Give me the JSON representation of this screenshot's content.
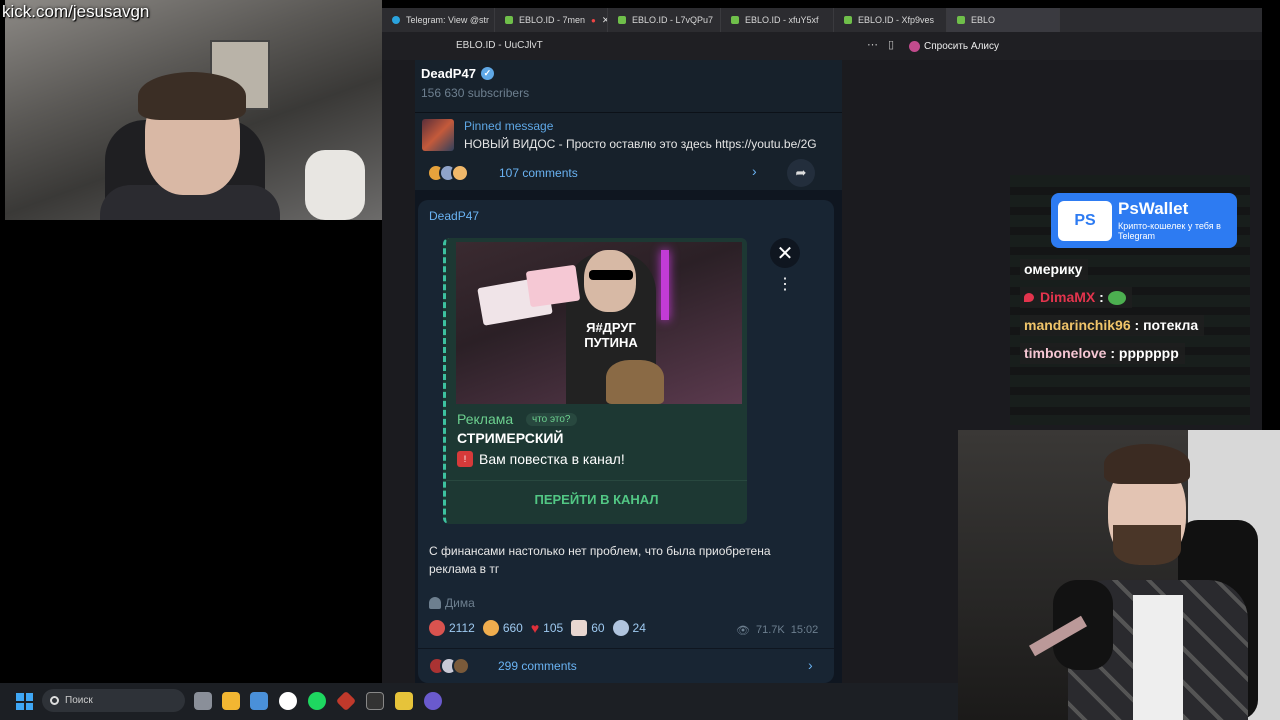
{
  "overlay": {
    "kick_url": "kick.com/jesusavgn"
  },
  "browser": {
    "tabs": [
      {
        "label": "Telegram: View @str",
        "active": false
      },
      {
        "label": "EBLO.ID - 7men",
        "active": false
      },
      {
        "label": "EBLO.ID - L7vQPu7",
        "active": false
      },
      {
        "label": "EBLO.ID - xfuY5xf",
        "active": false
      },
      {
        "label": "EBLO.ID - Xfp9ves",
        "active": false
      },
      {
        "label": "EBLO",
        "active": true
      }
    ],
    "address_title": "EBLO.ID - UuCJlvT",
    "alice_label": "Спросить Алису"
  },
  "telegram": {
    "channel_name": "DeadP47",
    "subscribers": "156 630 subscribers",
    "pinned": {
      "title": "Pinned message",
      "text": "НОВЫЙ ВИДОС - Просто оставлю это здесь  https://youtu.be/2G",
      "comments": "107 comments"
    },
    "post": {
      "author": "DeadP47",
      "ad": {
        "shirt_text": "Я#ДРУГ ПУТИНА",
        "label": "Реклама",
        "whats_this": "что это?",
        "title": "СТРИМЕРСКИЙ",
        "text": "Вам повестка в канал!",
        "button": "ПЕРЕЙТИ В КАНАЛ"
      },
      "text": "С финансами настолько нет проблем, что была приобретена реклама в тг",
      "signature": "Дима",
      "reactions": [
        {
          "count": "2112",
          "color": "#d9534f"
        },
        {
          "count": "660",
          "color": "#f0ad4e"
        },
        {
          "count": "105",
          "color": "#e0303a"
        },
        {
          "count": "60",
          "color": "#e8d6d0"
        },
        {
          "count": "24",
          "color": "#b0c4de"
        }
      ],
      "views": "71.7K",
      "time": "15:02",
      "comments": "299 comments"
    }
  },
  "chat": {
    "promo": {
      "logo": "PS",
      "name": "PsWallet",
      "tagline": "Крипто-кошелек у тебя в Telegram"
    },
    "messages": [
      {
        "user": "",
        "text": "омерику",
        "color": "#ffffff"
      },
      {
        "user": "DimaMX",
        "text": "",
        "color": "#e3344d"
      },
      {
        "user": "mandarinchik96",
        "text": "потекла",
        "color": "#f0c46a"
      },
      {
        "user": "timbonelove",
        "text": "ppppppp",
        "color": "#f5c6d3"
      }
    ]
  },
  "taskbar": {
    "search_placeholder": "Поиск"
  }
}
